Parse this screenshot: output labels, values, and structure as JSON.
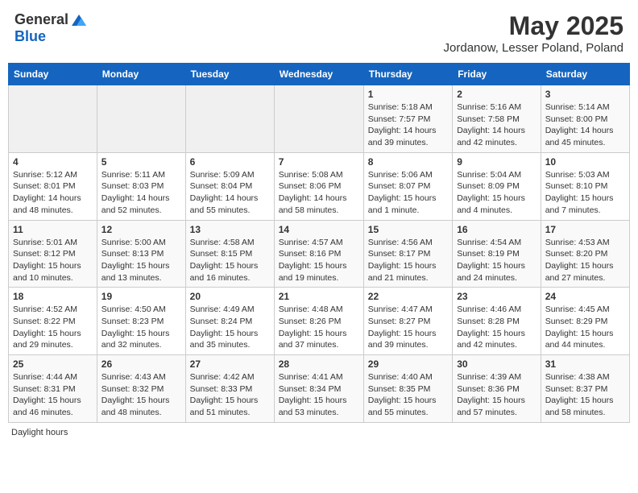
{
  "header": {
    "logo_general": "General",
    "logo_blue": "Blue",
    "month_title": "May 2025",
    "location": "Jordanow, Lesser Poland, Poland"
  },
  "days_of_week": [
    "Sunday",
    "Monday",
    "Tuesday",
    "Wednesday",
    "Thursday",
    "Friday",
    "Saturday"
  ],
  "weeks": [
    [
      {
        "day": "",
        "info": ""
      },
      {
        "day": "",
        "info": ""
      },
      {
        "day": "",
        "info": ""
      },
      {
        "day": "",
        "info": ""
      },
      {
        "day": "1",
        "info": "Sunrise: 5:18 AM\nSunset: 7:57 PM\nDaylight: 14 hours\nand 39 minutes."
      },
      {
        "day": "2",
        "info": "Sunrise: 5:16 AM\nSunset: 7:58 PM\nDaylight: 14 hours\nand 42 minutes."
      },
      {
        "day": "3",
        "info": "Sunrise: 5:14 AM\nSunset: 8:00 PM\nDaylight: 14 hours\nand 45 minutes."
      }
    ],
    [
      {
        "day": "4",
        "info": "Sunrise: 5:12 AM\nSunset: 8:01 PM\nDaylight: 14 hours\nand 48 minutes."
      },
      {
        "day": "5",
        "info": "Sunrise: 5:11 AM\nSunset: 8:03 PM\nDaylight: 14 hours\nand 52 minutes."
      },
      {
        "day": "6",
        "info": "Sunrise: 5:09 AM\nSunset: 8:04 PM\nDaylight: 14 hours\nand 55 minutes."
      },
      {
        "day": "7",
        "info": "Sunrise: 5:08 AM\nSunset: 8:06 PM\nDaylight: 14 hours\nand 58 minutes."
      },
      {
        "day": "8",
        "info": "Sunrise: 5:06 AM\nSunset: 8:07 PM\nDaylight: 15 hours\nand 1 minute."
      },
      {
        "day": "9",
        "info": "Sunrise: 5:04 AM\nSunset: 8:09 PM\nDaylight: 15 hours\nand 4 minutes."
      },
      {
        "day": "10",
        "info": "Sunrise: 5:03 AM\nSunset: 8:10 PM\nDaylight: 15 hours\nand 7 minutes."
      }
    ],
    [
      {
        "day": "11",
        "info": "Sunrise: 5:01 AM\nSunset: 8:12 PM\nDaylight: 15 hours\nand 10 minutes."
      },
      {
        "day": "12",
        "info": "Sunrise: 5:00 AM\nSunset: 8:13 PM\nDaylight: 15 hours\nand 13 minutes."
      },
      {
        "day": "13",
        "info": "Sunrise: 4:58 AM\nSunset: 8:15 PM\nDaylight: 15 hours\nand 16 minutes."
      },
      {
        "day": "14",
        "info": "Sunrise: 4:57 AM\nSunset: 8:16 PM\nDaylight: 15 hours\nand 19 minutes."
      },
      {
        "day": "15",
        "info": "Sunrise: 4:56 AM\nSunset: 8:17 PM\nDaylight: 15 hours\nand 21 minutes."
      },
      {
        "day": "16",
        "info": "Sunrise: 4:54 AM\nSunset: 8:19 PM\nDaylight: 15 hours\nand 24 minutes."
      },
      {
        "day": "17",
        "info": "Sunrise: 4:53 AM\nSunset: 8:20 PM\nDaylight: 15 hours\nand 27 minutes."
      }
    ],
    [
      {
        "day": "18",
        "info": "Sunrise: 4:52 AM\nSunset: 8:22 PM\nDaylight: 15 hours\nand 29 minutes."
      },
      {
        "day": "19",
        "info": "Sunrise: 4:50 AM\nSunset: 8:23 PM\nDaylight: 15 hours\nand 32 minutes."
      },
      {
        "day": "20",
        "info": "Sunrise: 4:49 AM\nSunset: 8:24 PM\nDaylight: 15 hours\nand 35 minutes."
      },
      {
        "day": "21",
        "info": "Sunrise: 4:48 AM\nSunset: 8:26 PM\nDaylight: 15 hours\nand 37 minutes."
      },
      {
        "day": "22",
        "info": "Sunrise: 4:47 AM\nSunset: 8:27 PM\nDaylight: 15 hours\nand 39 minutes."
      },
      {
        "day": "23",
        "info": "Sunrise: 4:46 AM\nSunset: 8:28 PM\nDaylight: 15 hours\nand 42 minutes."
      },
      {
        "day": "24",
        "info": "Sunrise: 4:45 AM\nSunset: 8:29 PM\nDaylight: 15 hours\nand 44 minutes."
      }
    ],
    [
      {
        "day": "25",
        "info": "Sunrise: 4:44 AM\nSunset: 8:31 PM\nDaylight: 15 hours\nand 46 minutes."
      },
      {
        "day": "26",
        "info": "Sunrise: 4:43 AM\nSunset: 8:32 PM\nDaylight: 15 hours\nand 48 minutes."
      },
      {
        "day": "27",
        "info": "Sunrise: 4:42 AM\nSunset: 8:33 PM\nDaylight: 15 hours\nand 51 minutes."
      },
      {
        "day": "28",
        "info": "Sunrise: 4:41 AM\nSunset: 8:34 PM\nDaylight: 15 hours\nand 53 minutes."
      },
      {
        "day": "29",
        "info": "Sunrise: 4:40 AM\nSunset: 8:35 PM\nDaylight: 15 hours\nand 55 minutes."
      },
      {
        "day": "30",
        "info": "Sunrise: 4:39 AM\nSunset: 8:36 PM\nDaylight: 15 hours\nand 57 minutes."
      },
      {
        "day": "31",
        "info": "Sunrise: 4:38 AM\nSunset: 8:37 PM\nDaylight: 15 hours\nand 58 minutes."
      }
    ]
  ],
  "footer": {
    "note": "Daylight hours"
  }
}
